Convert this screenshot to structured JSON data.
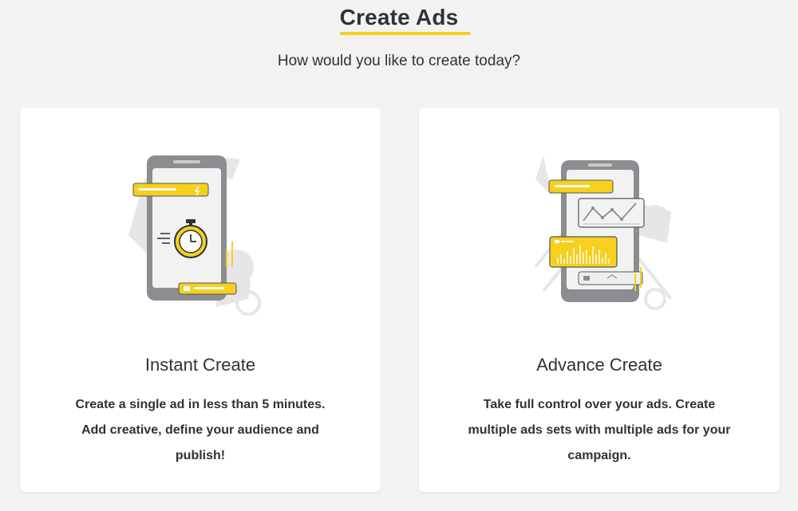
{
  "header": {
    "title": "Create Ads",
    "subtitle": "How would you like to create today?"
  },
  "options": [
    {
      "title": "Instant Create",
      "description": "Create a single ad in less than 5 minutes. Add creative, define your audience and publish!",
      "illustration": "phone-stopwatch-icon"
    },
    {
      "title": "Advance Create",
      "description": "Take full control over your ads. Create multiple ads sets with multiple ads for your campaign.",
      "illustration": "phone-charts-icon"
    }
  ],
  "colors": {
    "accent": "#f5d01e",
    "text": "#2f3236",
    "background": "#f2f2f2",
    "card": "#ffffff",
    "illustration_gray": "#8b8d90",
    "illustration_light": "#e6e6e6"
  }
}
